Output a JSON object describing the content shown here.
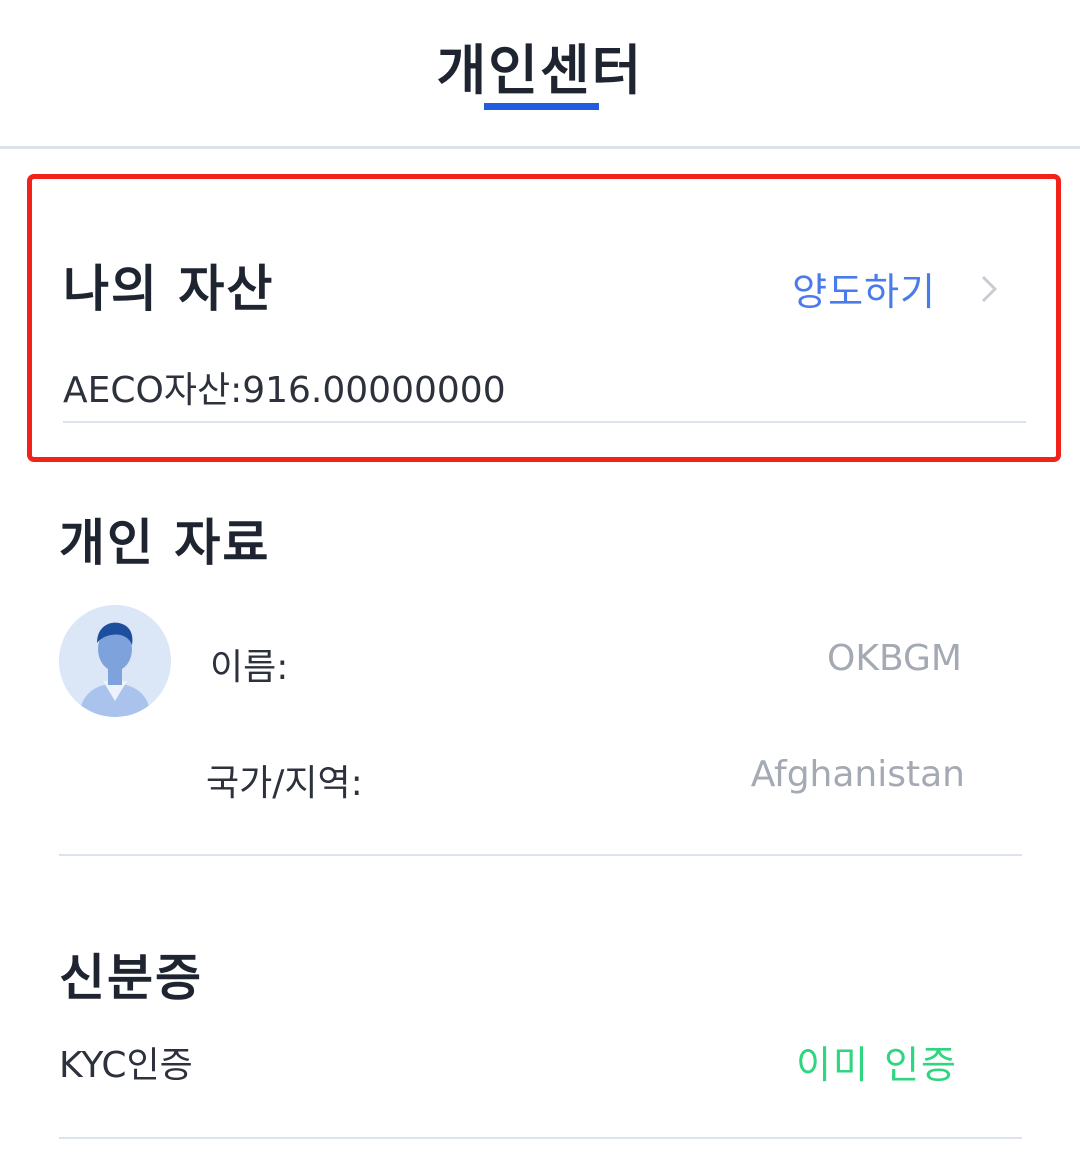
{
  "header": {
    "title": "개인센터"
  },
  "assets": {
    "title": "나의 자산",
    "transfer_label": "양도하기",
    "balance_text": "AECO자산:916.00000000"
  },
  "profile": {
    "title": "개인 자료",
    "name_label": "이름:",
    "name_value": "OKBGM",
    "region_label": "국가/지역:",
    "region_value": "Afghanistan"
  },
  "identity": {
    "title": "신분증",
    "kyc_label": "KYC인증",
    "kyc_status": "이미 인증"
  },
  "colors": {
    "accent_blue": "#1f5de0",
    "link_blue": "#4a7bea",
    "highlight_red": "#f2221a",
    "verified_green": "#2fd67f",
    "muted_gray": "#a4aab4"
  }
}
